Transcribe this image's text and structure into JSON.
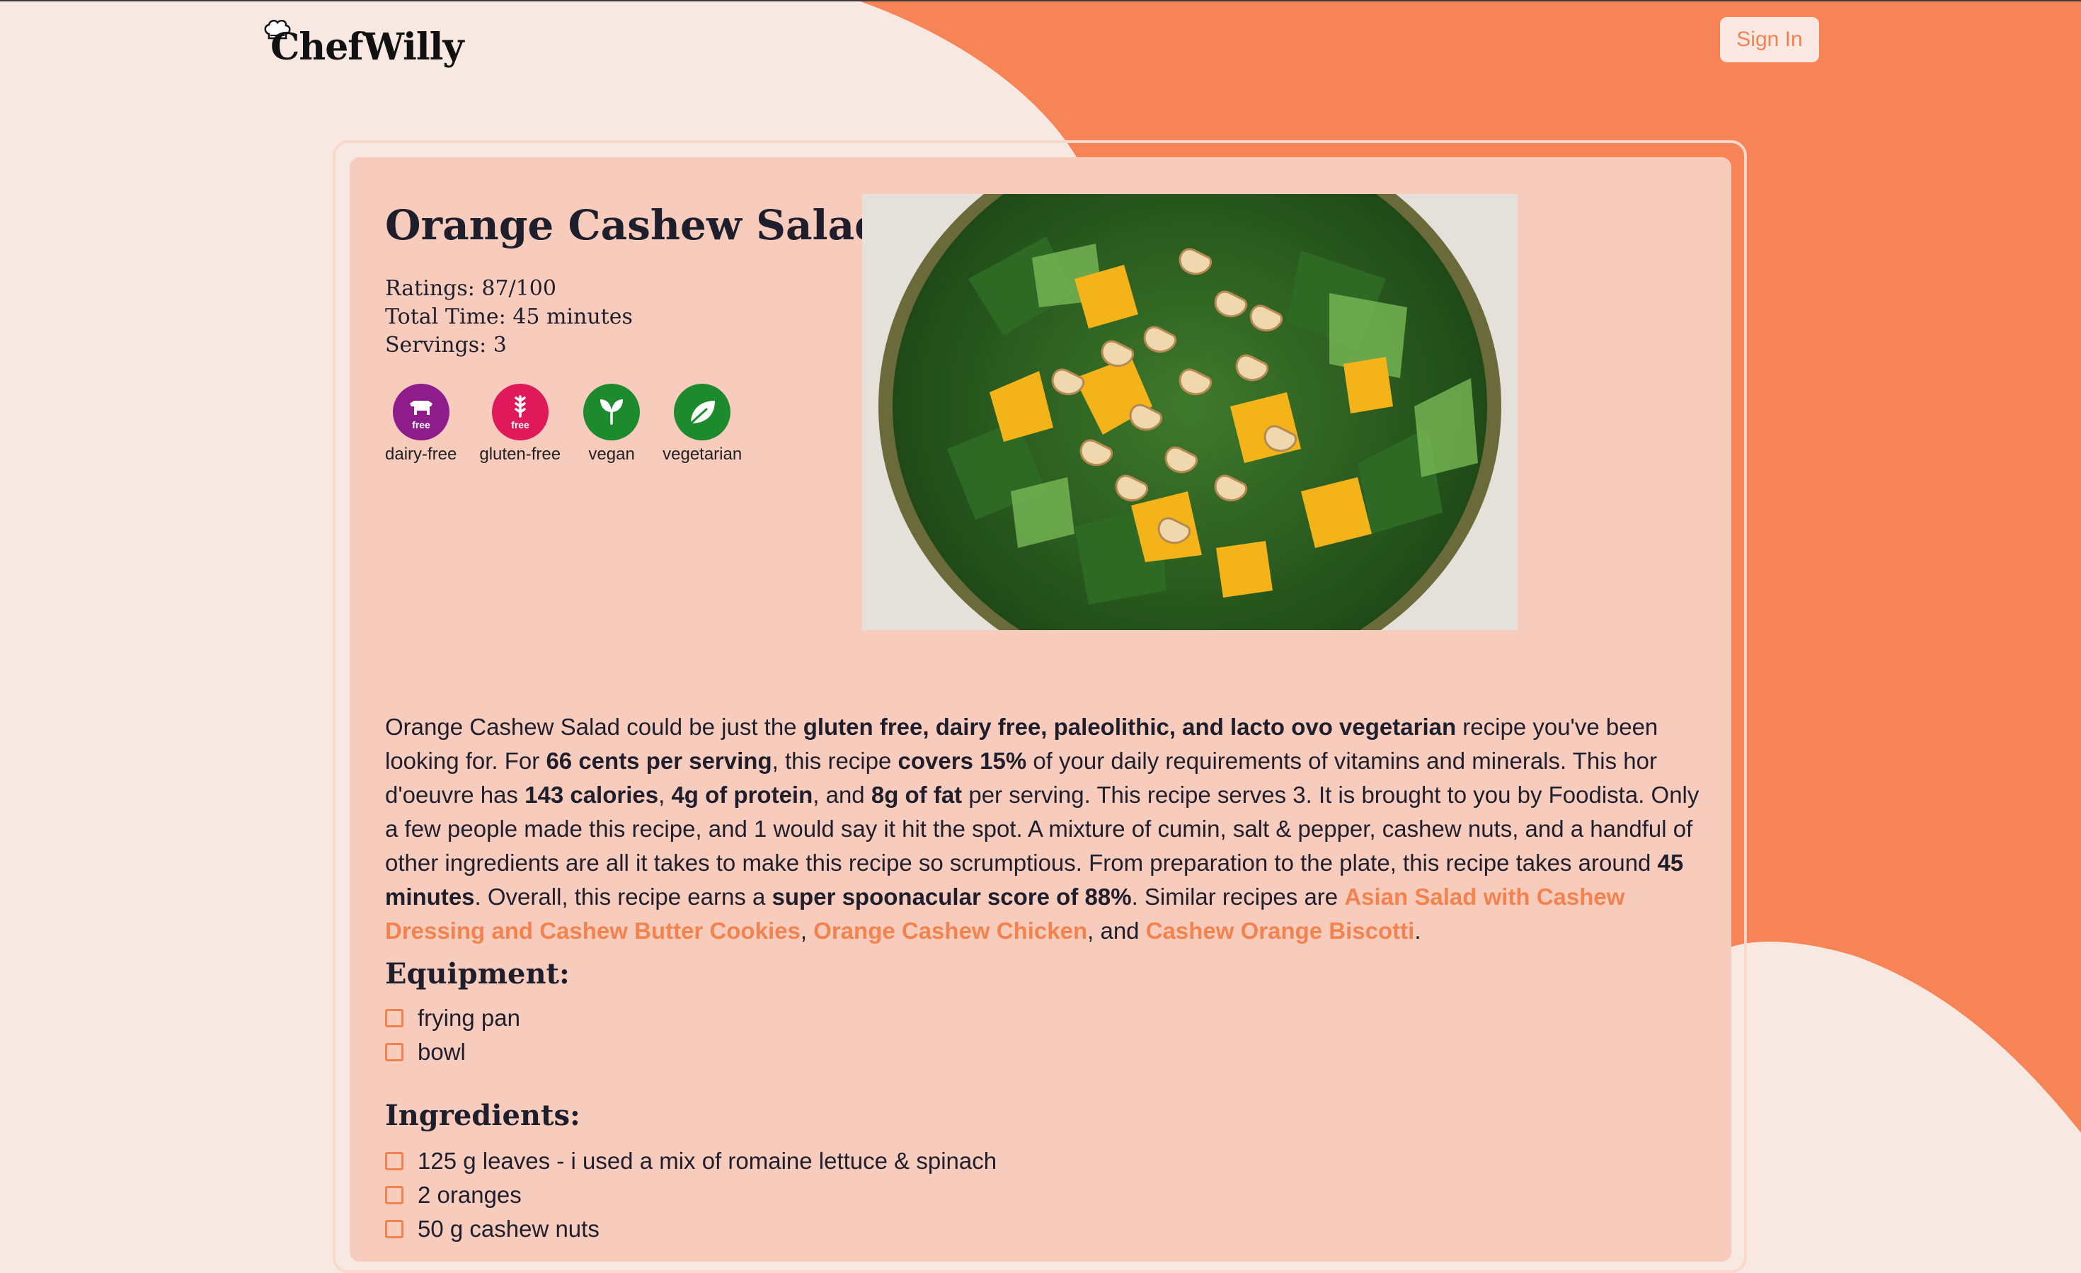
{
  "header": {
    "logo_text": "ChefWilly",
    "sign_in_label": "Sign In"
  },
  "recipe": {
    "title": "Orange Cashew Salad",
    "ratings": "Ratings: 87/100",
    "total_time": "Total Time: 45 minutes",
    "servings": "Servings: 3",
    "badges": [
      {
        "label": "dairy-free",
        "icon": "cow-icon",
        "sub": "free",
        "color": "#8e1c8a"
      },
      {
        "label": "gluten-free",
        "icon": "wheat-icon",
        "sub": "free",
        "color": "#e0195a"
      },
      {
        "label": "vegan",
        "icon": "sprout-icon",
        "sub": "",
        "color": "#1e8a2e"
      },
      {
        "label": "vegetarian",
        "icon": "leaf-icon",
        "sub": "",
        "color": "#1e8a2e"
      }
    ],
    "image_alt": "orange-cashew-salad-photo",
    "description": {
      "p1": "Orange Cashew Salad could be just the ",
      "b1": "gluten free, dairy free, paleolithic, and lacto ovo vegetarian",
      "p2": " recipe you've been looking for. For ",
      "b2": "66 cents per serving",
      "p3": ", this recipe ",
      "b3": "covers 15%",
      "p4": " of your daily requirements of vitamins and minerals. This hor d'oeuvre has ",
      "b4": "143 calories",
      "p5": ", ",
      "b5": "4g of protein",
      "p6": ", and ",
      "b6": "8g of fat",
      "p7": " per serving. This recipe serves 3. It is brought to you by Foodista. Only a few people made this recipe, and 1 would say it hit the spot. A mixture of cumin, salt & pepper, cashew nuts, and a handful of other ingredients are all it takes to make this recipe so scrumptious. From preparation to the plate, this recipe takes around ",
      "b7": "45 minutes",
      "p8": ". Overall, this recipe earns a ",
      "b8": "super spoonacular score of 88%",
      "p9": ". Similar recipes are ",
      "link1": "Asian Salad with Cashew Dressing and Cashew Butter Cookies",
      "p10": ", ",
      "link2": "Orange Cashew Chicken",
      "p11": ", and ",
      "link3": "Cashew Orange Biscotti",
      "p12": "."
    },
    "equipment_title": "Equipment:",
    "equipment": [
      "frying pan",
      "bowl"
    ],
    "ingredients_title": "Ingredients:",
    "ingredients": [
      "125 g leaves - i used a mix of romaine lettuce & spinach",
      "2 oranges",
      "50 g cashew nuts"
    ]
  },
  "colors": {
    "background": "#f7e9e2",
    "accent_orange": "#f78457",
    "card": "#f8ccbd",
    "link": "#f2834f"
  }
}
